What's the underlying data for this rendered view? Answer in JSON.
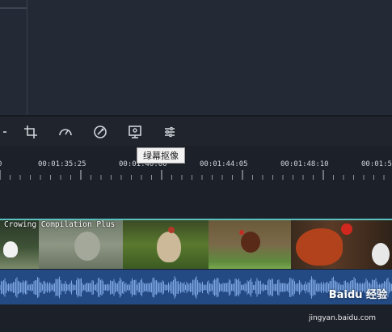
{
  "toolbar": {
    "tools": [
      {
        "name": "partial-tool",
        "icon": "edge-icon"
      },
      {
        "name": "crop",
        "icon": "crop-icon"
      },
      {
        "name": "speed",
        "icon": "speedometer-icon"
      },
      {
        "name": "color",
        "icon": "color-adjust-icon"
      },
      {
        "name": "green-screen",
        "icon": "green-screen-icon"
      },
      {
        "name": "adjust",
        "icon": "sliders-icon"
      }
    ],
    "tooltip": "绿幕抠像"
  },
  "ruler": {
    "labels": [
      "0",
      "00:01:35:25",
      "00:01:40:00",
      "00:01:44:05",
      "00:01:48:10",
      "00:01:52"
    ]
  },
  "video_track": {
    "clip_title": "Crowing Compilation Plus",
    "accent": "#5bc1bf"
  },
  "audio_track": {
    "color": "#244a84",
    "wave_color": "#7da6e0"
  },
  "watermark": {
    "brand": "Baidu 经验",
    "url": "jingyan.baidu.com"
  }
}
